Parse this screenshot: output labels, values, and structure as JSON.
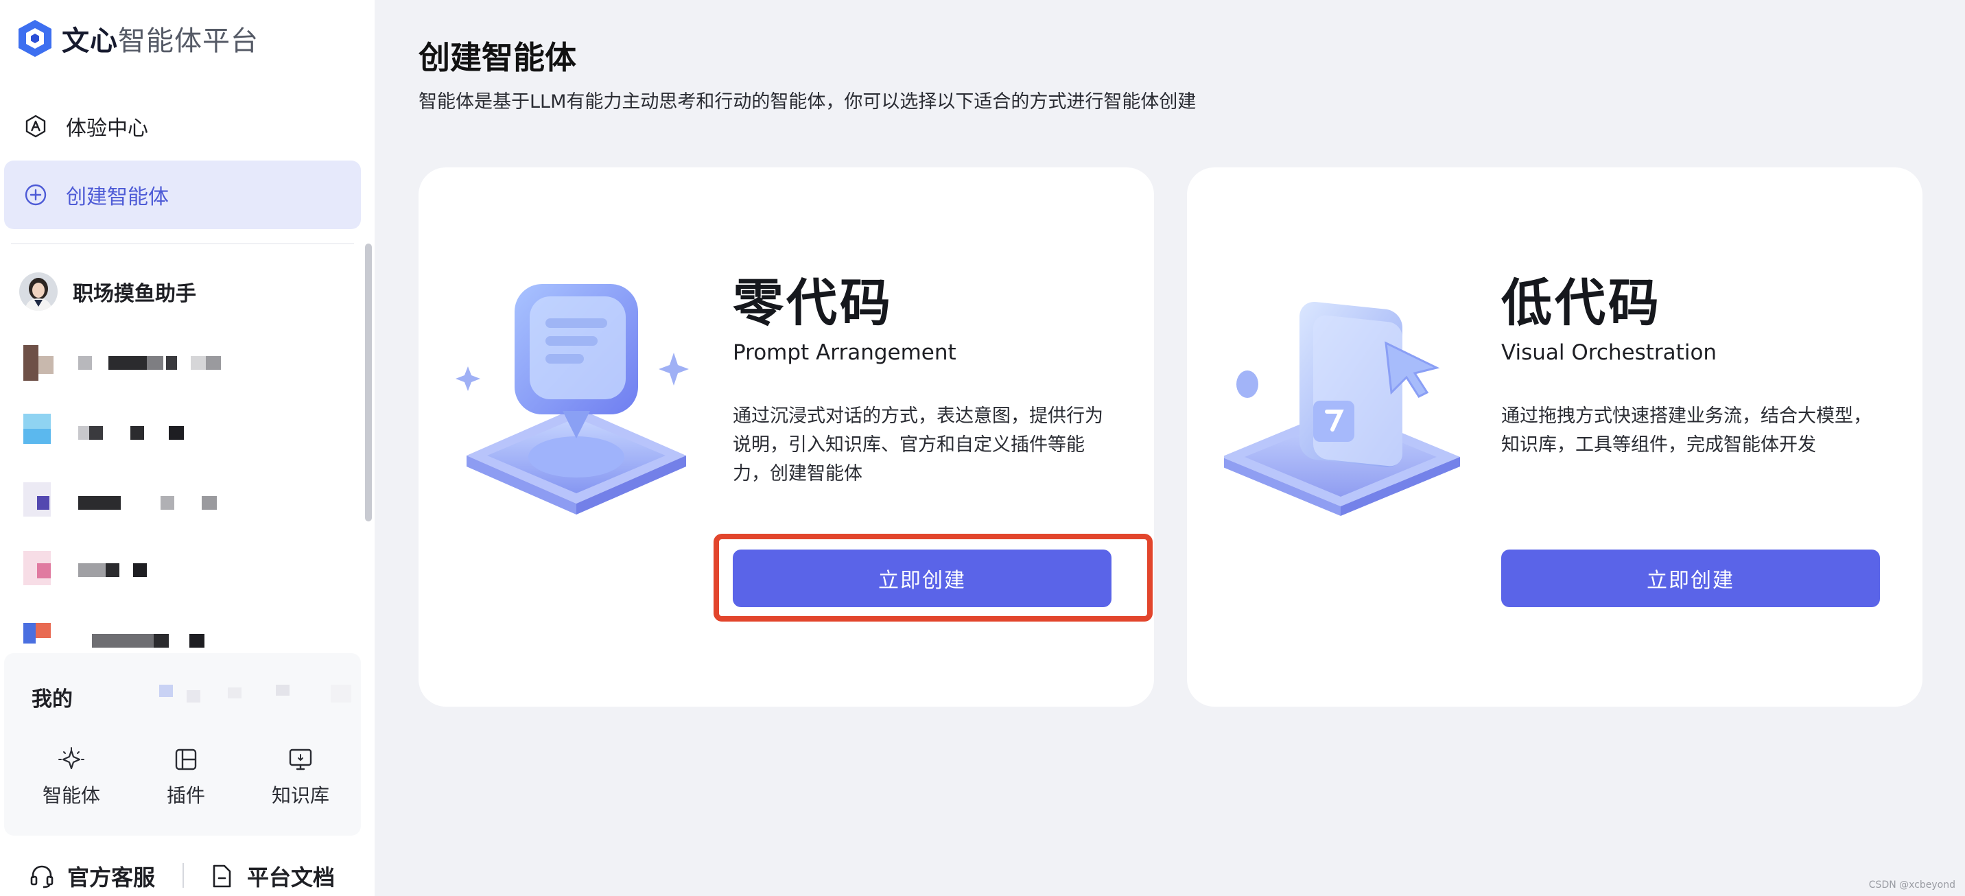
{
  "app": {
    "logo_bold": "文心",
    "logo_rest": "智能体平台"
  },
  "sidebar": {
    "nav": [
      {
        "label": "体验中心",
        "icon": "letter-a-hexagon-icon"
      },
      {
        "label": "创建智能体",
        "icon": "plus-circle-icon",
        "active": true
      }
    ],
    "agents": [
      {
        "name": "职场摸鱼助手"
      }
    ],
    "my": {
      "title": "我的",
      "items": [
        {
          "label": "智能体",
          "icon": "sparkle-icon"
        },
        {
          "label": "插件",
          "icon": "plugin-icon"
        },
        {
          "label": "知识库",
          "icon": "knowledge-icon"
        }
      ]
    },
    "footer": {
      "support": "官方客服",
      "docs": "平台文档"
    }
  },
  "main": {
    "title": "创建智能体",
    "subtitle": "智能体是基于LLM有能力主动思考和行动的智能体，你可以选择以下适合的方式进行智能体创建",
    "cards": [
      {
        "heading": "零代码",
        "subheading": "Prompt Arrangement",
        "description": "通过沉浸式对话的方式，表达意图，提供行为说明，引入知识库、官方和自定义插件等能力，创建智能体",
        "button": "立即创建"
      },
      {
        "heading": "低代码",
        "subheading": "Visual Orchestration",
        "description": "通过拖拽方式快速搭建业务流，结合大模型，知识库，工具等组件，完成智能体开发",
        "button": "立即创建"
      }
    ]
  },
  "watermark": "CSDN @xcbeyond",
  "colors": {
    "accent": "#5a64e8",
    "active_bg": "#e6e9fb",
    "highlight": "#e2452c"
  }
}
